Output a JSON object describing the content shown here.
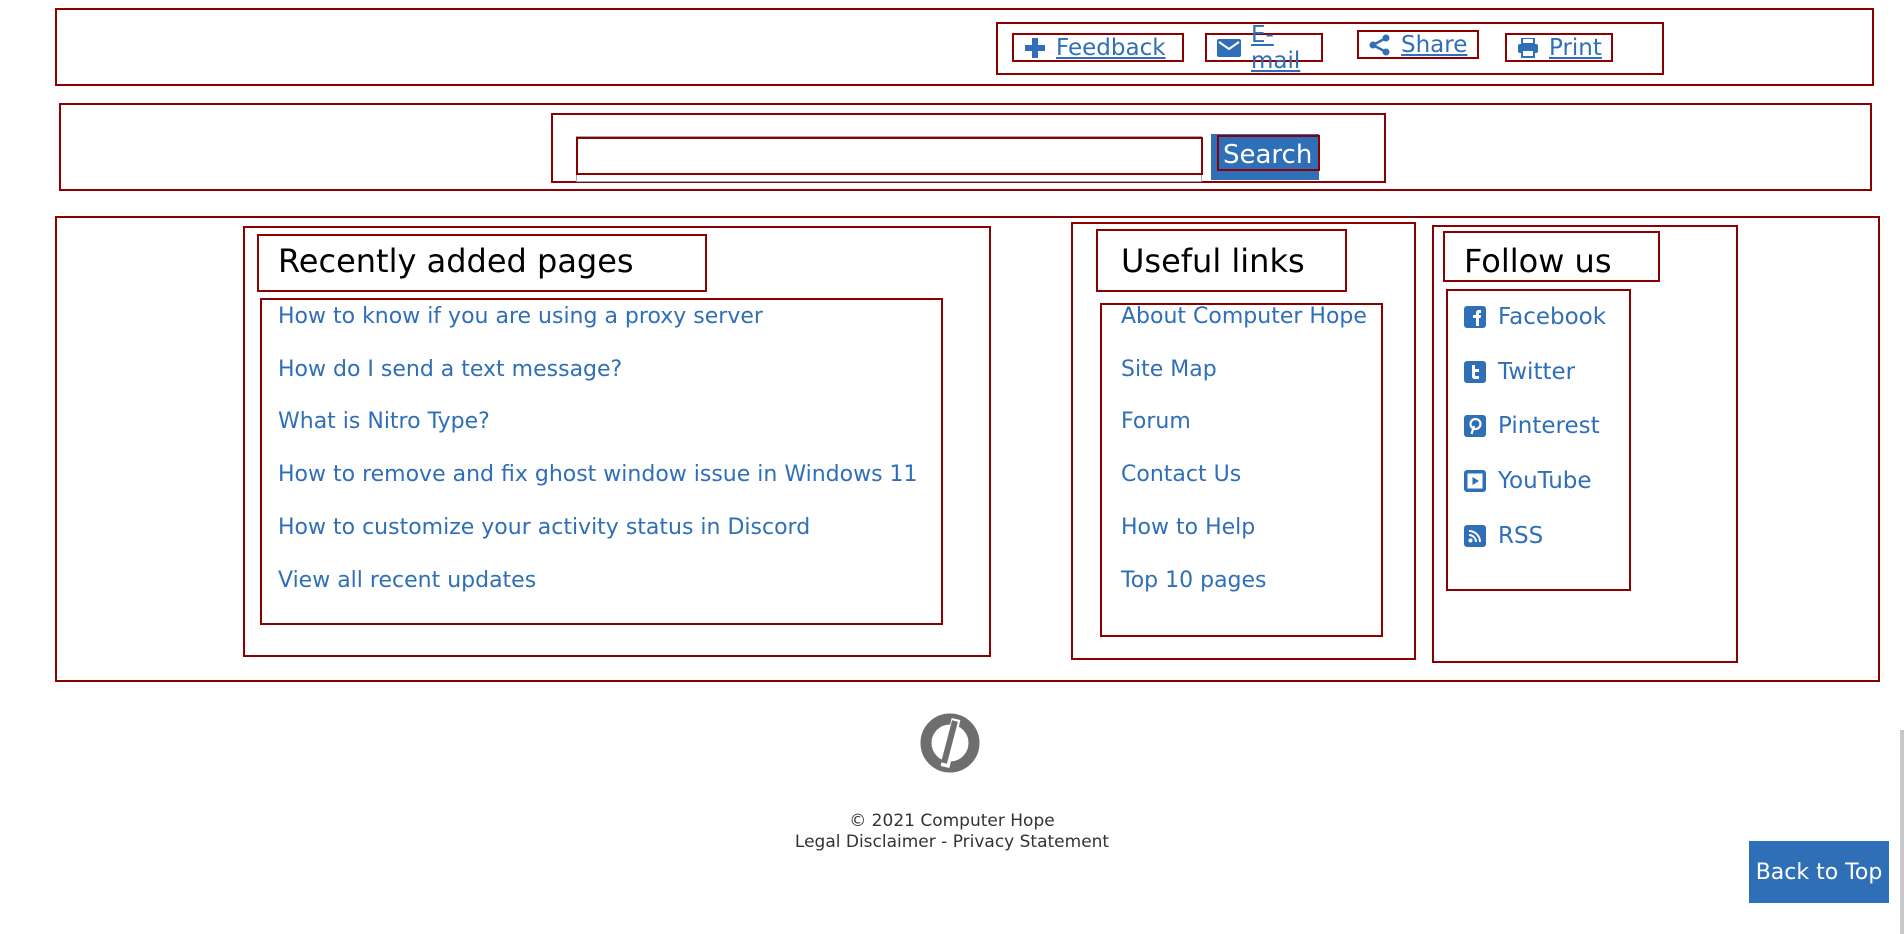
{
  "toolbar": {
    "feedback": "Feedback",
    "email": "E-mail",
    "share": "Share",
    "print": "Print"
  },
  "search": {
    "button_label": "Search",
    "value": "",
    "placeholder": ""
  },
  "recent": {
    "title": "Recently added pages",
    "items": [
      "How to know if you are using a proxy server",
      "How do I send a text message?",
      "What is Nitro Type?",
      "How to remove and fix ghost window issue in Windows 11",
      "How to customize your activity status in Discord",
      "View all recent updates"
    ]
  },
  "useful": {
    "title": "Useful links",
    "items": [
      "About Computer Hope",
      "Site Map",
      "Forum",
      "Contact Us",
      "How to Help",
      "Top 10 pages"
    ]
  },
  "follow": {
    "title": "Follow us",
    "items": [
      {
        "label": "Facebook",
        "icon": "facebook-icon"
      },
      {
        "label": "Twitter",
        "icon": "twitter-icon"
      },
      {
        "label": "Pinterest",
        "icon": "pinterest-icon"
      },
      {
        "label": "YouTube",
        "icon": "youtube-icon"
      },
      {
        "label": "RSS",
        "icon": "rss-icon"
      }
    ]
  },
  "footer": {
    "copyright": "© 2021 Computer Hope",
    "legal": "Legal Disclaimer - Privacy Statement"
  },
  "back_to_top": "Back to Top",
  "colors": {
    "link": "#2f6fb7",
    "outline": "#8b0000",
    "logo": "#6e6e6e"
  }
}
